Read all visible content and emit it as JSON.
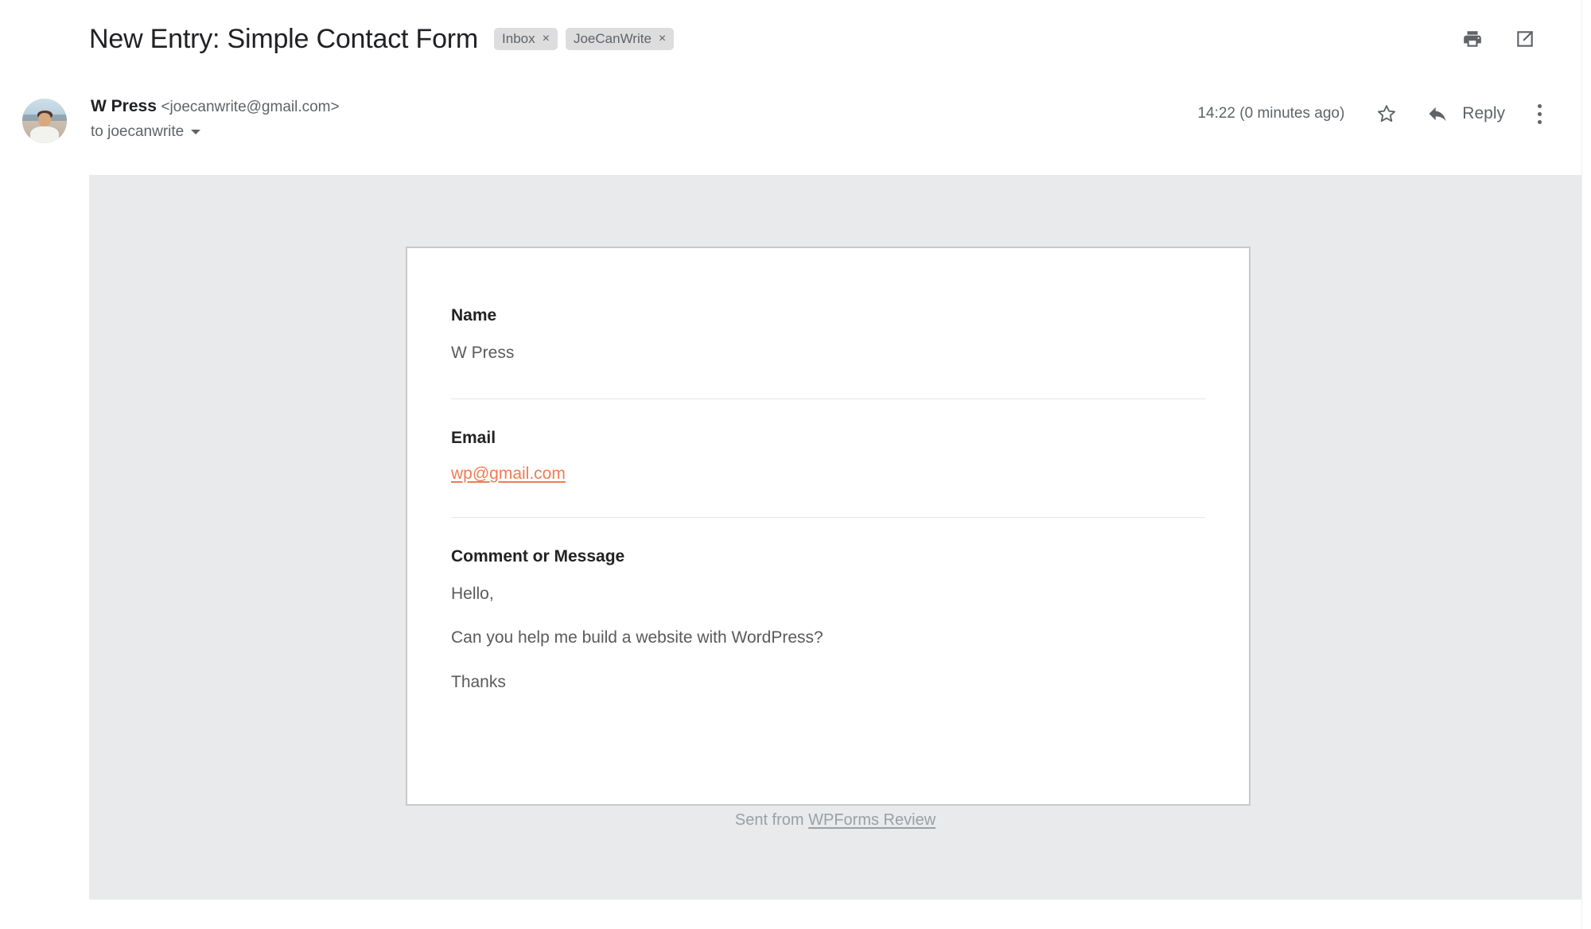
{
  "header": {
    "subject": "New Entry: Simple Contact Form",
    "labels": [
      {
        "name": "Inbox",
        "remove": "×"
      },
      {
        "name": "JoeCanWrite",
        "remove": "×"
      }
    ],
    "actions": {
      "print": "print-icon",
      "open_in_new": "open-in-new-window-icon"
    }
  },
  "message": {
    "sender_name": "W Press",
    "sender_email": "<joecanwrite@gmail.com>",
    "recipient": "to joecanwrite",
    "timestamp": "14:22 (0 minutes ago)",
    "star": "star-outline-icon",
    "reply_label": "Reply",
    "more_options": "more-options-icon"
  },
  "form": {
    "fields": [
      {
        "label": "Name",
        "value": "W Press",
        "is_link": false
      },
      {
        "label": "Email",
        "value": "wp@gmail.com",
        "is_link": true
      },
      {
        "label": "Comment or Message",
        "paragraphs": [
          "Hello,",
          "Can you help me build a website with WordPress?",
          "Thanks"
        ]
      }
    ]
  },
  "footer": {
    "sent_from_prefix": "Sent from ",
    "sent_from_link": "WPForms Review"
  },
  "colors": {
    "link_orange": "#f07c52",
    "body_gray": "#e8eaeb",
    "text_dark": "#202124",
    "text_muted": "#5f6368",
    "chip_bg": "#ddddde"
  }
}
